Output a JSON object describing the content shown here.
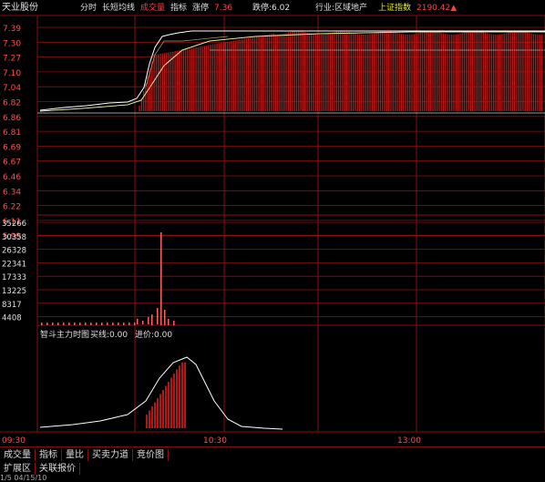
{
  "header": {
    "stock_name": "天业股份",
    "items": [
      {
        "label": "分时",
        "color": "#e0e0e0"
      },
      {
        "label": "长短均线",
        "color": "#e0e0e0"
      },
      {
        "label": "成交量",
        "color": "#ff4040"
      },
      {
        "label": "指标",
        "color": "#e0e0e0"
      },
      {
        "label": "涨停",
        "color": "#e0e0e0"
      },
      {
        "label": "7.36",
        "color": "#ff4040"
      },
      {
        "label": "跌停:6.02",
        "color": "#e0e0e0"
      },
      {
        "label": "行业:区域地产",
        "color": "#e0e0e0"
      },
      {
        "label": "上证指数",
        "color": "#e8e82a"
      },
      {
        "label": "2190.42▲",
        "color": "#ff4040"
      }
    ]
  },
  "price_axis": [
    "7.39",
    "7.30",
    "7.27",
    "7.10",
    "7.04",
    "6.82",
    "6.86",
    "6.81",
    "6.69",
    "6.67",
    "6.46",
    "6.34",
    "6.22",
    "6.11",
    "5.99"
  ],
  "volume_axis": [
    "35266",
    "30358",
    "26328",
    "22341",
    "17333",
    "13225",
    "8317",
    "4408"
  ],
  "subchart": {
    "title": "智斗主力时图",
    "buy_label": "买线:0.00",
    "sell_label": "进价:0.00"
  },
  "time_axis": [
    "09:30",
    "10:30",
    "13:00"
  ],
  "bottom_tabs": [
    "成交量",
    "指标",
    "量比",
    "买卖力道",
    "竞价图"
  ],
  "bottom_tabs2": [
    "扩展区",
    "关联报价"
  ],
  "footer_text": "1/5 04/15/10",
  "colors": {
    "grid": "#8a1010",
    "up": "#b01818",
    "price_line": "#ffffff",
    "avg_line": "#e8e8a0",
    "yellow": "#e8e82a"
  }
}
